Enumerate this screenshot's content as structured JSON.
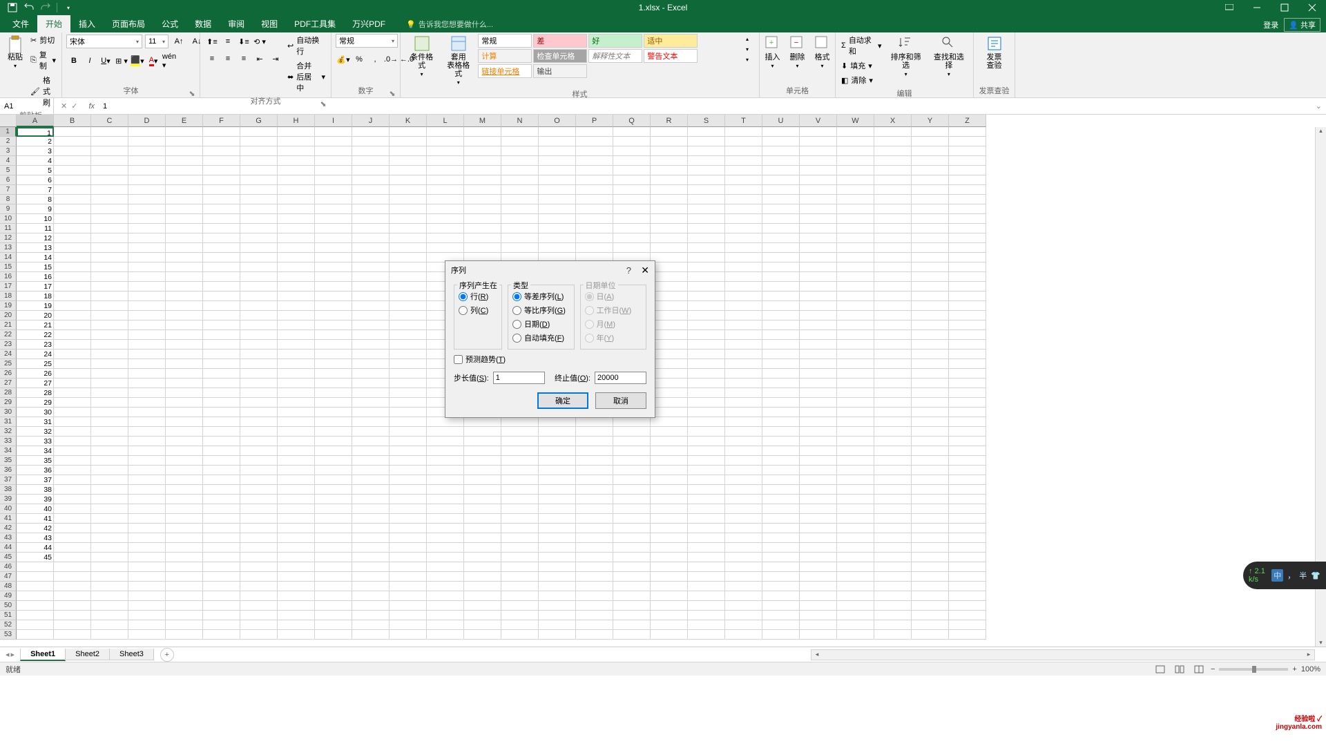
{
  "title": "1.xlsx - Excel",
  "qat": {
    "save": "保存",
    "undo": "撤销",
    "redo": "恢复"
  },
  "tabs": {
    "file": "文件",
    "home": "开始",
    "insert": "插入",
    "layout": "页面布局",
    "formula": "公式",
    "data": "数据",
    "review": "审阅",
    "view": "视图",
    "pdf": "PDF工具集",
    "wanxing": "万兴PDF",
    "tell": "告诉我您想要做什么...",
    "login": "登录",
    "share": "共享"
  },
  "ribbon": {
    "clipboard": {
      "label": "剪贴板",
      "paste": "粘贴",
      "cut": "剪切",
      "copy": "复制",
      "painter": "格式刷"
    },
    "font": {
      "label": "字体",
      "name": "宋体",
      "size": "11"
    },
    "align": {
      "label": "对齐方式",
      "wrap": "自动换行",
      "merge": "合并后居中"
    },
    "number": {
      "label": "数字",
      "format": "常规"
    },
    "styles": {
      "label": "样式",
      "cond": "条件格式",
      "table": "套用\n表格格式",
      "items": [
        {
          "t": "常规",
          "bg": "#ffffff",
          "c": "#000"
        },
        {
          "t": "差",
          "bg": "#ffc7ce",
          "c": "#9c0006"
        },
        {
          "t": "好",
          "bg": "#c6efce",
          "c": "#006100"
        },
        {
          "t": "适中",
          "bg": "#ffeb9c",
          "c": "#9c5700"
        },
        {
          "t": "计算",
          "bg": "#f2f2f2",
          "c": "#fa7d00"
        },
        {
          "t": "检查单元格",
          "bg": "#a5a5a5",
          "c": "#fff"
        },
        {
          "t": "解释性文本",
          "bg": "#ffffff",
          "c": "#7f7f7f"
        },
        {
          "t": "警告文本",
          "bg": "#ffffff",
          "c": "#ff0000"
        },
        {
          "t": "链接单元格",
          "bg": "#ffffff",
          "c": "#fa7d00"
        },
        {
          "t": "输出",
          "bg": "#f2f2f2",
          "c": "#3f3f3f"
        }
      ]
    },
    "cells": {
      "label": "单元格",
      "insert": "插入",
      "delete": "删除",
      "format": "格式"
    },
    "editing": {
      "label": "编辑",
      "sum": "自动求和",
      "fill": "填充",
      "clear": "清除",
      "sort": "排序和筛选",
      "find": "查找和选择"
    },
    "invoice": {
      "label": "发票查验",
      "btn": "发票\n查验"
    }
  },
  "namebox": "A1",
  "formula": "1",
  "columns": [
    "A",
    "B",
    "C",
    "D",
    "E",
    "F",
    "G",
    "H",
    "I",
    "J",
    "K",
    "L",
    "M",
    "N",
    "O",
    "P",
    "Q",
    "R",
    "S",
    "T",
    "U",
    "V",
    "W",
    "X",
    "Y",
    "Z"
  ],
  "rows_data": [
    1,
    2,
    3,
    4,
    5,
    6,
    7,
    8,
    9,
    10,
    11,
    12,
    13,
    14,
    15,
    16,
    17,
    18,
    19,
    20,
    21,
    22,
    23,
    24,
    25,
    26,
    27,
    28,
    29,
    30,
    31,
    32,
    33,
    34,
    35,
    36,
    37,
    38,
    39,
    40,
    41,
    42,
    43,
    44,
    45
  ],
  "dialog": {
    "title": "序列",
    "grp1": {
      "legend": "序列产生在",
      "row": "行(R)",
      "col": "列(C)"
    },
    "grp2": {
      "legend": "类型",
      "arith": "等差序列(L)",
      "geo": "等比序列(G)",
      "date": "日期(D)",
      "auto": "自动填充(F)"
    },
    "grp3": {
      "legend": "日期单位",
      "day": "日(A)",
      "weekday": "工作日(W)",
      "month": "月(M)",
      "year": "年(Y)"
    },
    "trend": "预测趋势(T)",
    "step_label": "步长值(S):",
    "step_val": "1",
    "stop_label": "终止值(O):",
    "stop_val": "20000",
    "ok": "确定",
    "cancel": "取消"
  },
  "sheets": {
    "s1": "Sheet1",
    "s2": "Sheet2",
    "s3": "Sheet3"
  },
  "status": {
    "ready": "就绪",
    "zoom": "100%"
  },
  "ime": {
    "speed": "2.1 k/s",
    "cn": "中",
    "punct": "，",
    "half": "半"
  },
  "watermark": "经验啦 ✓\njingyanla.com"
}
